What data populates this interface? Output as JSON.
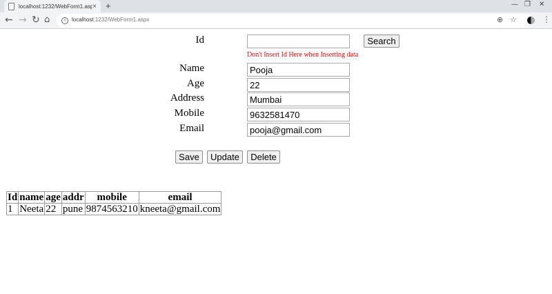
{
  "browser": {
    "tab_title": "localhost:1232/WebForm1.aspx",
    "tab_close": "×",
    "new_tab": "+",
    "url_host": "localhost",
    "url_path": ":1232/WebForm1.aspx",
    "minimize": "—",
    "maximize": "❐",
    "close": "✕"
  },
  "form": {
    "id_label": "Id",
    "id_value": "",
    "search_label": "Search",
    "id_warning": "Don't Insert Id Here when Inserting data",
    "name_label": "Name",
    "name_value": "Pooja",
    "age_label": "Age",
    "age_value": "22",
    "address_label": "Address",
    "address_value": "Mumbai",
    "mobile_label": "Mobile",
    "mobile_value": "9632581470",
    "email_label": "Email",
    "email_value": "pooja@gmail.com",
    "save_label": "Save",
    "update_label": "Update",
    "delete_label": "Delete"
  },
  "grid": {
    "headers": [
      "Id",
      "name",
      "age",
      "addr",
      "mobile",
      "email"
    ],
    "rows": [
      [
        "1",
        "Neeta",
        "22",
        "pune",
        "9874563210",
        "kneeta@gmail.com"
      ]
    ]
  },
  "colors": {
    "warning": "#ff0000"
  }
}
